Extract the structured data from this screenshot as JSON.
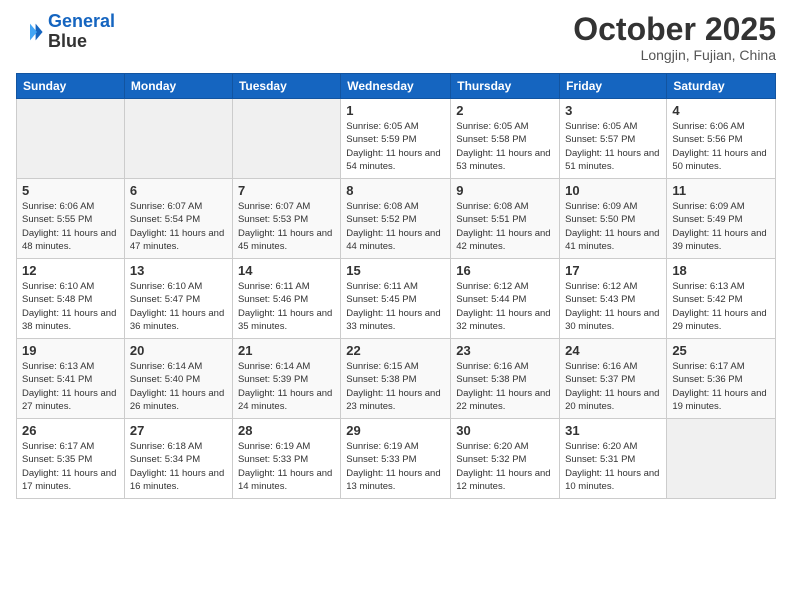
{
  "header": {
    "logo_line1": "General",
    "logo_line2": "Blue",
    "month": "October 2025",
    "location": "Longjin, Fujian, China"
  },
  "weekdays": [
    "Sunday",
    "Monday",
    "Tuesday",
    "Wednesday",
    "Thursday",
    "Friday",
    "Saturday"
  ],
  "weeks": [
    [
      {
        "day": "",
        "sunrise": "",
        "sunset": "",
        "daylight": ""
      },
      {
        "day": "",
        "sunrise": "",
        "sunset": "",
        "daylight": ""
      },
      {
        "day": "",
        "sunrise": "",
        "sunset": "",
        "daylight": ""
      },
      {
        "day": "1",
        "sunrise": "Sunrise: 6:05 AM",
        "sunset": "Sunset: 5:59 PM",
        "daylight": "Daylight: 11 hours and 54 minutes."
      },
      {
        "day": "2",
        "sunrise": "Sunrise: 6:05 AM",
        "sunset": "Sunset: 5:58 PM",
        "daylight": "Daylight: 11 hours and 53 minutes."
      },
      {
        "day": "3",
        "sunrise": "Sunrise: 6:05 AM",
        "sunset": "Sunset: 5:57 PM",
        "daylight": "Daylight: 11 hours and 51 minutes."
      },
      {
        "day": "4",
        "sunrise": "Sunrise: 6:06 AM",
        "sunset": "Sunset: 5:56 PM",
        "daylight": "Daylight: 11 hours and 50 minutes."
      }
    ],
    [
      {
        "day": "5",
        "sunrise": "Sunrise: 6:06 AM",
        "sunset": "Sunset: 5:55 PM",
        "daylight": "Daylight: 11 hours and 48 minutes."
      },
      {
        "day": "6",
        "sunrise": "Sunrise: 6:07 AM",
        "sunset": "Sunset: 5:54 PM",
        "daylight": "Daylight: 11 hours and 47 minutes."
      },
      {
        "day": "7",
        "sunrise": "Sunrise: 6:07 AM",
        "sunset": "Sunset: 5:53 PM",
        "daylight": "Daylight: 11 hours and 45 minutes."
      },
      {
        "day": "8",
        "sunrise": "Sunrise: 6:08 AM",
        "sunset": "Sunset: 5:52 PM",
        "daylight": "Daylight: 11 hours and 44 minutes."
      },
      {
        "day": "9",
        "sunrise": "Sunrise: 6:08 AM",
        "sunset": "Sunset: 5:51 PM",
        "daylight": "Daylight: 11 hours and 42 minutes."
      },
      {
        "day": "10",
        "sunrise": "Sunrise: 6:09 AM",
        "sunset": "Sunset: 5:50 PM",
        "daylight": "Daylight: 11 hours and 41 minutes."
      },
      {
        "day": "11",
        "sunrise": "Sunrise: 6:09 AM",
        "sunset": "Sunset: 5:49 PM",
        "daylight": "Daylight: 11 hours and 39 minutes."
      }
    ],
    [
      {
        "day": "12",
        "sunrise": "Sunrise: 6:10 AM",
        "sunset": "Sunset: 5:48 PM",
        "daylight": "Daylight: 11 hours and 38 minutes."
      },
      {
        "day": "13",
        "sunrise": "Sunrise: 6:10 AM",
        "sunset": "Sunset: 5:47 PM",
        "daylight": "Daylight: 11 hours and 36 minutes."
      },
      {
        "day": "14",
        "sunrise": "Sunrise: 6:11 AM",
        "sunset": "Sunset: 5:46 PM",
        "daylight": "Daylight: 11 hours and 35 minutes."
      },
      {
        "day": "15",
        "sunrise": "Sunrise: 6:11 AM",
        "sunset": "Sunset: 5:45 PM",
        "daylight": "Daylight: 11 hours and 33 minutes."
      },
      {
        "day": "16",
        "sunrise": "Sunrise: 6:12 AM",
        "sunset": "Sunset: 5:44 PM",
        "daylight": "Daylight: 11 hours and 32 minutes."
      },
      {
        "day": "17",
        "sunrise": "Sunrise: 6:12 AM",
        "sunset": "Sunset: 5:43 PM",
        "daylight": "Daylight: 11 hours and 30 minutes."
      },
      {
        "day": "18",
        "sunrise": "Sunrise: 6:13 AM",
        "sunset": "Sunset: 5:42 PM",
        "daylight": "Daylight: 11 hours and 29 minutes."
      }
    ],
    [
      {
        "day": "19",
        "sunrise": "Sunrise: 6:13 AM",
        "sunset": "Sunset: 5:41 PM",
        "daylight": "Daylight: 11 hours and 27 minutes."
      },
      {
        "day": "20",
        "sunrise": "Sunrise: 6:14 AM",
        "sunset": "Sunset: 5:40 PM",
        "daylight": "Daylight: 11 hours and 26 minutes."
      },
      {
        "day": "21",
        "sunrise": "Sunrise: 6:14 AM",
        "sunset": "Sunset: 5:39 PM",
        "daylight": "Daylight: 11 hours and 24 minutes."
      },
      {
        "day": "22",
        "sunrise": "Sunrise: 6:15 AM",
        "sunset": "Sunset: 5:38 PM",
        "daylight": "Daylight: 11 hours and 23 minutes."
      },
      {
        "day": "23",
        "sunrise": "Sunrise: 6:16 AM",
        "sunset": "Sunset: 5:38 PM",
        "daylight": "Daylight: 11 hours and 22 minutes."
      },
      {
        "day": "24",
        "sunrise": "Sunrise: 6:16 AM",
        "sunset": "Sunset: 5:37 PM",
        "daylight": "Daylight: 11 hours and 20 minutes."
      },
      {
        "day": "25",
        "sunrise": "Sunrise: 6:17 AM",
        "sunset": "Sunset: 5:36 PM",
        "daylight": "Daylight: 11 hours and 19 minutes."
      }
    ],
    [
      {
        "day": "26",
        "sunrise": "Sunrise: 6:17 AM",
        "sunset": "Sunset: 5:35 PM",
        "daylight": "Daylight: 11 hours and 17 minutes."
      },
      {
        "day": "27",
        "sunrise": "Sunrise: 6:18 AM",
        "sunset": "Sunset: 5:34 PM",
        "daylight": "Daylight: 11 hours and 16 minutes."
      },
      {
        "day": "28",
        "sunrise": "Sunrise: 6:19 AM",
        "sunset": "Sunset: 5:33 PM",
        "daylight": "Daylight: 11 hours and 14 minutes."
      },
      {
        "day": "29",
        "sunrise": "Sunrise: 6:19 AM",
        "sunset": "Sunset: 5:33 PM",
        "daylight": "Daylight: 11 hours and 13 minutes."
      },
      {
        "day": "30",
        "sunrise": "Sunrise: 6:20 AM",
        "sunset": "Sunset: 5:32 PM",
        "daylight": "Daylight: 11 hours and 12 minutes."
      },
      {
        "day": "31",
        "sunrise": "Sunrise: 6:20 AM",
        "sunset": "Sunset: 5:31 PM",
        "daylight": "Daylight: 11 hours and 10 minutes."
      },
      {
        "day": "",
        "sunrise": "",
        "sunset": "",
        "daylight": ""
      }
    ]
  ]
}
